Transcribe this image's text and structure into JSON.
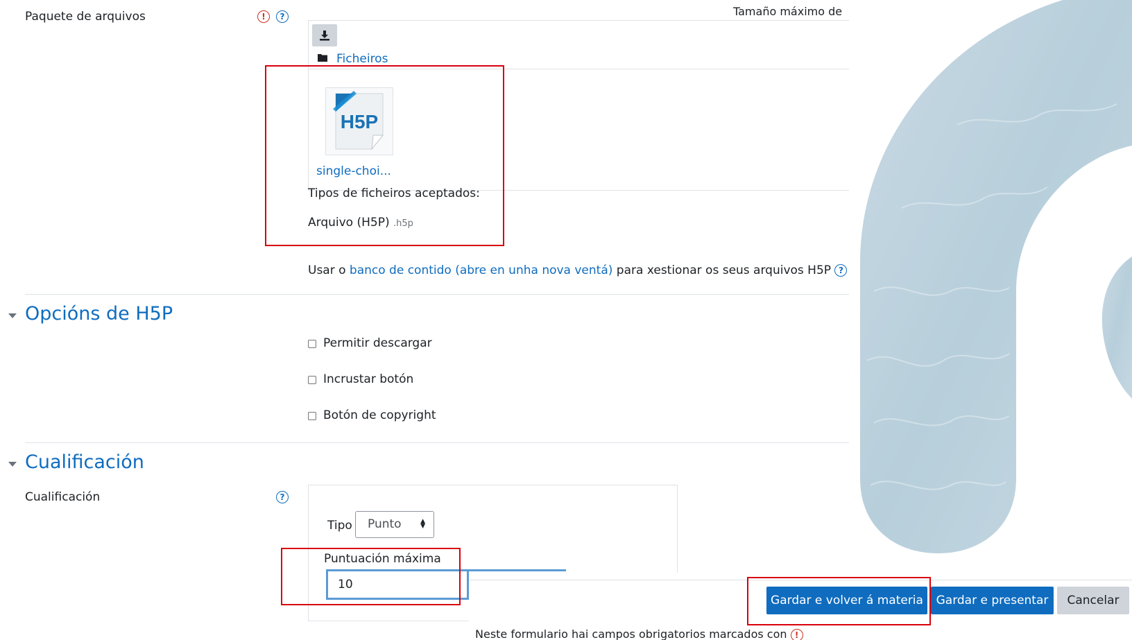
{
  "file_field": {
    "label": "Paquete de arquivos",
    "max_size_label": "Tamaño máximo de",
    "folder_link": "Ficheiros",
    "file_name": "single-choi...",
    "accepted_types_label": "Tipos de ficheiros aceptados:",
    "accepted_type_name": "Arquivo (H5P)",
    "accepted_type_ext": ".h5p",
    "content_bank_prefix": "Usar o",
    "content_bank_link": "banco de contido (abre en unha nova ventá)",
    "content_bank_suffix": "para xestionar os seus arquivos H5P"
  },
  "h5p_options": {
    "title": "Opcións de H5P",
    "checkboxes": [
      {
        "label": "Permitir descargar",
        "checked": false
      },
      {
        "label": "Incrustar botón",
        "checked": false
      },
      {
        "label": "Botón de copyright",
        "checked": false
      }
    ]
  },
  "grading": {
    "title": "Cualificación",
    "field_label": "Cualificación",
    "type_label": "Tipo",
    "type_value": "Punto",
    "max_grade_label": "Puntuación máxima",
    "max_grade_value": "10"
  },
  "footer": {
    "save_return_label": "Gardar e volver á materia",
    "save_display_label": "Gardar e presentar",
    "cancel_label": "Cancelar",
    "required_note": "Neste formulario hai campos obrigatorios marcados con"
  },
  "colors": {
    "primary": "#0f6cbf",
    "required": "#ca3120",
    "highlight": "#d9000d"
  }
}
